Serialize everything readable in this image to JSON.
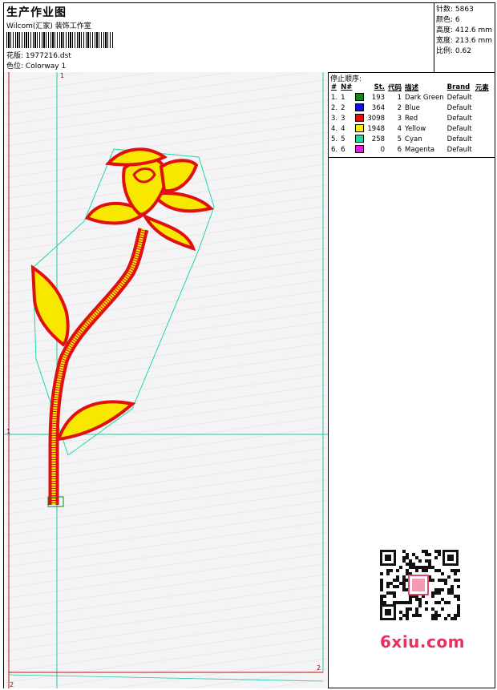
{
  "header": {
    "title": "生产作业图",
    "subtitle": "Wilcom(汇家) 装饰工作室",
    "design_label": "花版:",
    "design_value": "1977216.dst",
    "colorway_label": "色位:",
    "colorway_value": "Colorway 1"
  },
  "stats": {
    "stitches": "针数: 5863",
    "colors": "颜色: 6",
    "height": "高度: 412.6 mm",
    "width": "宽度: 213.6 mm",
    "scale": "比例: 0.62"
  },
  "sequence": {
    "heading": "停止顺序:",
    "columns": [
      "#",
      "N#",
      "St.",
      "代码",
      "描述",
      "Brand",
      "元素"
    ],
    "rows": [
      {
        "idx": "1.",
        "n": "1",
        "color": "#108a10",
        "st": "193",
        "code": "1",
        "desc": "Dark Green",
        "brand": "Default"
      },
      {
        "idx": "2.",
        "n": "2",
        "color": "#1010e0",
        "st": "364",
        "code": "2",
        "desc": "Blue",
        "brand": "Default"
      },
      {
        "idx": "3.",
        "n": "3",
        "color": "#e01010",
        "st": "3098",
        "code": "3",
        "desc": "Red",
        "brand": "Default"
      },
      {
        "idx": "4.",
        "n": "4",
        "color": "#f8f000",
        "st": "1948",
        "code": "4",
        "desc": "Yellow",
        "brand": "Default"
      },
      {
        "idx": "5.",
        "n": "5",
        "color": "#20d8a0",
        "st": "258",
        "code": "5",
        "desc": "Cyan",
        "brand": "Default"
      },
      {
        "idx": "6.",
        "n": "6",
        "color": "#e020e0",
        "st": "0",
        "code": "6",
        "desc": "Magenta",
        "brand": "Default"
      }
    ]
  },
  "canvas": {
    "marker_top": "1",
    "marker_left": "1",
    "marker_bottom_right": "2",
    "marker_bottom_left": "2"
  },
  "watermark": "6xiu.com"
}
